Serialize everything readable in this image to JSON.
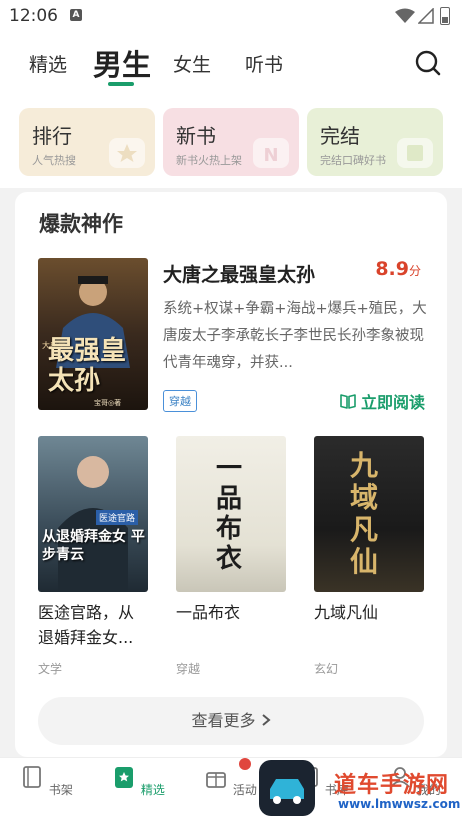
{
  "status": {
    "time": "12:06",
    "notif": "A"
  },
  "tabs": [
    {
      "label": "精选"
    },
    {
      "label": "男生"
    },
    {
      "label": "女生"
    },
    {
      "label": "听书"
    }
  ],
  "categories": [
    {
      "title": "排行",
      "sub": "人气热搜",
      "color": "#f6ecd9"
    },
    {
      "title": "新书",
      "sub": "新书火热上架",
      "color": "#f7dfe3"
    },
    {
      "title": "完结",
      "sub": "完结口碑好书",
      "color": "#e8f0d7"
    }
  ],
  "section": {
    "title": "爆款神作"
  },
  "featured": {
    "title": "大唐之最强皇太孙",
    "score": "8.9",
    "score_unit": "分",
    "desc": "系统+权谋+争霸+海战+爆兵+殖民，大唐废太子李承乾长子李世民长孙李象被现代青年魂穿，并获...",
    "tag": "穿越",
    "read_label": "立即阅读",
    "cover_text": "最强皇太孙",
    "cover_small": "大唐之",
    "cover_author": "宝哥◎著"
  },
  "books": [
    {
      "title": "医途官路，从退婚拜金女...",
      "category": "文学",
      "cover_text": "从退婚拜金女 平步青云",
      "cover_small": "医途官路"
    },
    {
      "title": "一品布衣",
      "category": "穿越",
      "cover_text": "一品布衣"
    },
    {
      "title": "九域凡仙",
      "category": "玄幻",
      "cover_text": "九域凡仙"
    }
  ],
  "more_label": "查看更多",
  "bottom_nav": [
    {
      "label": "书架"
    },
    {
      "label": "精选"
    },
    {
      "label": "活动"
    },
    {
      "label": "书库"
    },
    {
      "label": "我的"
    }
  ],
  "watermark": {
    "line1": "道车手游网",
    "line2": "www.lmwwsz.com"
  },
  "colors": {
    "accent": "#1a9d6b",
    "score": "#d9432b"
  }
}
